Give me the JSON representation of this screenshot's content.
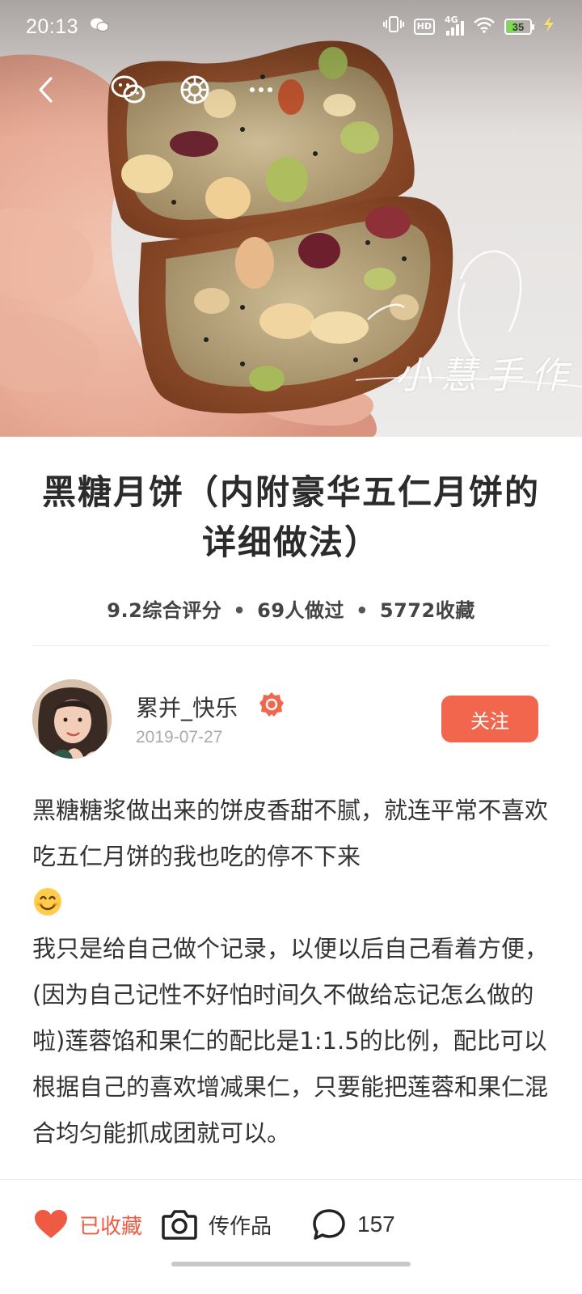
{
  "status_bar": {
    "time": "20:13",
    "network": "4G",
    "hd": "HD",
    "battery": "35",
    "battery_level": 0.35,
    "icons": [
      "wechat-icon",
      "vibrate-icon",
      "hd-icon",
      "signal-icon",
      "wifi-icon",
      "battery-icon",
      "charging-icon"
    ]
  },
  "hero": {
    "watermark": "小慧手作"
  },
  "nav": {
    "icons": [
      "back-icon",
      "wechat-share-icon",
      "moments-share-icon",
      "more-icon"
    ]
  },
  "recipe": {
    "title": "黑糖月饼（内附豪华五仁月饼的详细做法）",
    "stats": {
      "rating": "9.2综合评分",
      "made": "69人做过",
      "saved": "5772收藏"
    }
  },
  "author": {
    "name": "累并_快乐",
    "date": "2019-07-27",
    "follow_label": "关注"
  },
  "description": {
    "paragraph1": "黑糖糖浆做出来的饼皮香甜不腻，就连平常不喜欢吃五仁月饼的我也吃的停不下来",
    "emoji": "smile-emoji",
    "paragraph2": "我只是给自己做个记录，以便以后自己看着方便，(因为自己记性不好怕时间久不做给忘记怎么做的啦)莲蓉馅和果仁的配比是1:1.5的比例，配比可以根据自己的喜欢增减果仁，只要能把莲蓉和果仁混合均匀能抓成团就可以。"
  },
  "bottom_bar": {
    "favorite_label": "已收藏",
    "upload_label": "传作品",
    "comment_count": "157",
    "accent_color": "#ee5a43"
  },
  "colors": {
    "follow_button": "#f1664c",
    "favorite": "#ee5a43"
  }
}
